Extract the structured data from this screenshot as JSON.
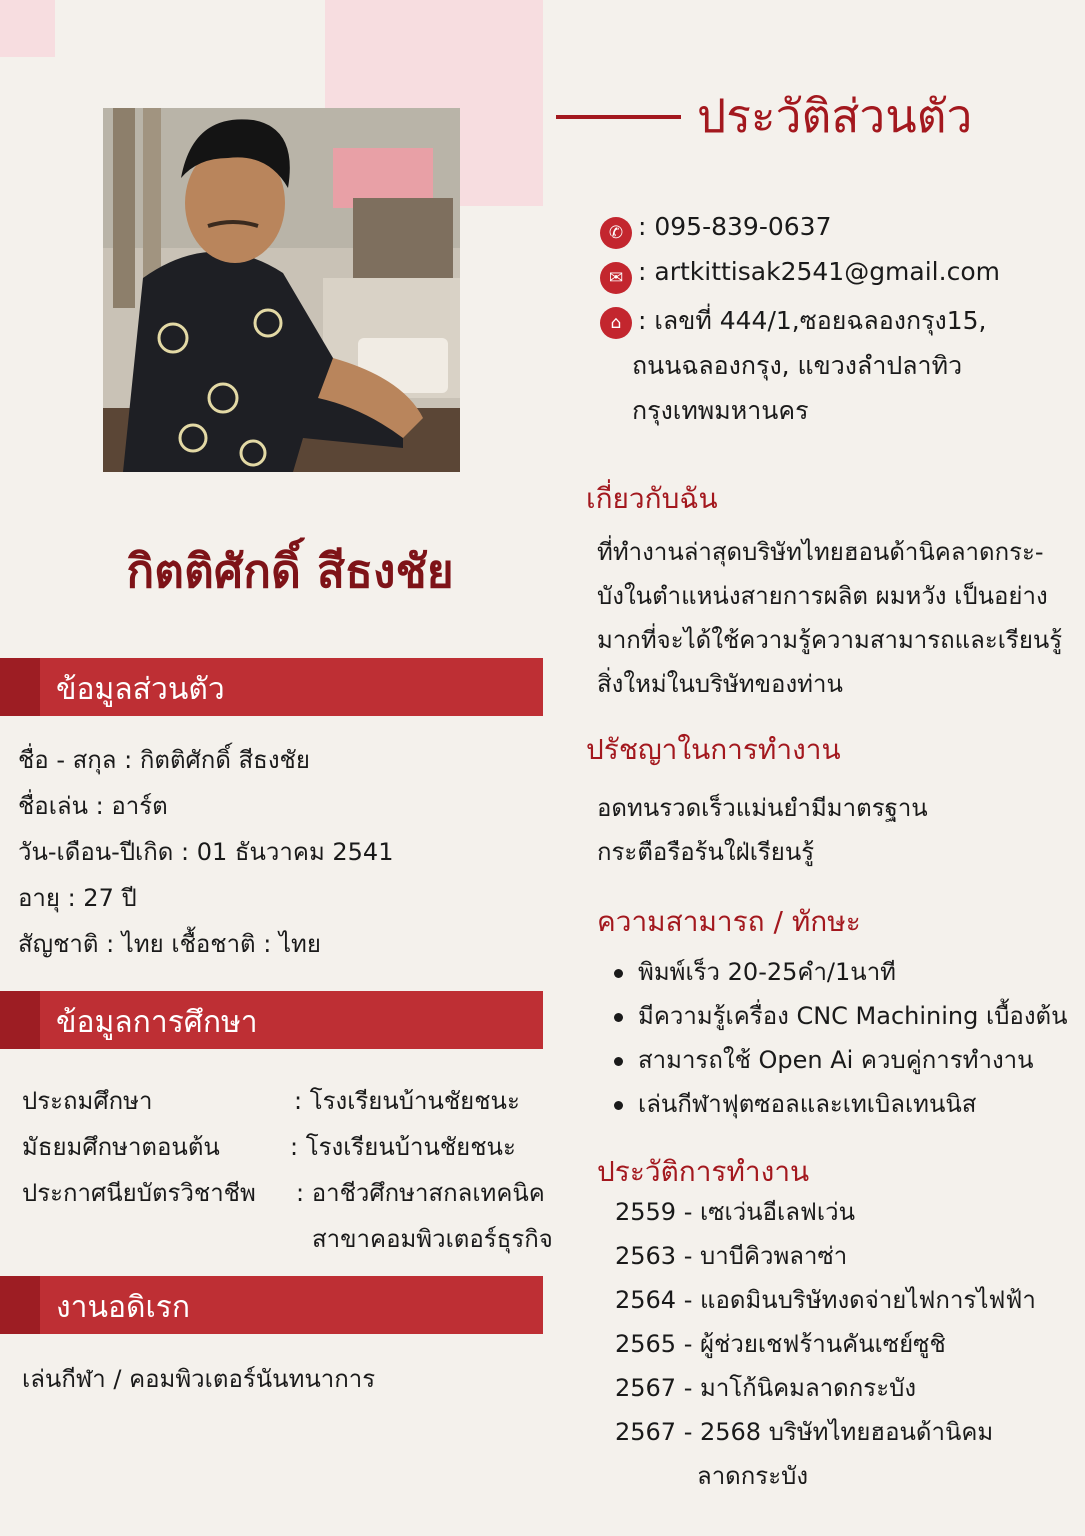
{
  "colors": {
    "accent": "#a3181e",
    "bar": "#be2f34",
    "bar_cap": "#9d1d23",
    "pink": "#f7dde0",
    "background": "#f4f1ec"
  },
  "name": "กิตติศักดิ์ สีธงชัย",
  "headline": "ประวัติส่วนตัว",
  "contact": {
    "phone": ": 095-839-0637",
    "email": ": artkittisak2541@gmail.com",
    "address_lines": [
      ": เลขที่ 444/1,ซอยฉลองกรุง15,",
      "ถนนฉลองกรุง, แขวงลำปลาทิว",
      "กรุงเทพมหานคร"
    ],
    "icons": [
      "phone-icon",
      "email-icon",
      "home-icon"
    ]
  },
  "personal": {
    "heading": "ข้อมูลส่วนตัว",
    "lines": [
      "ชื่อ - สกุล : กิตติศักดิ์ สีธงชัย",
      "ชื่อเล่น : อาร์ต",
      "วัน-เดือน-ปีเกิด : 01 ธันวาคม 2541",
      "อายุ : 27 ปี",
      "สัญชาติ : ไทย  เชื้อชาติ : ไทย"
    ]
  },
  "education": {
    "heading": "ข้อมูลการศึกษา",
    "rows": [
      {
        "level": "ประถมศึกษา",
        "school": ": โรงเรียนบ้านชัยชนะ"
      },
      {
        "level": "มัธยมศึกษาตอนต้น",
        "school": ": โรงเรียนบ้านชัยชนะ"
      },
      {
        "level": "ประกาศนียบัตรวิชาชีพ",
        "school": ": อาชีวศึกษาสกลเทคนิค"
      }
    ],
    "extra_line": "สาขาคอมพิวเตอร์ธุรกิจ"
  },
  "hobby": {
    "heading": "งานอดิเรก",
    "text": "เล่นกีฬา / คอมพิวเตอร์นันทนาการ"
  },
  "about": {
    "heading": "เกี่ยวกับฉัน",
    "lines": [
      "ที่ทำงานล่าสุดบริษัทไทยฮอนด้านิคลาดกระ-",
      "บังในตำแหน่งสายการผลิต ผมหวัง เป็นอย่าง",
      "มากที่จะได้ใช้ความรู้ความสามารถและเรียนรู้",
      "สิ่งใหม่ในบริษัทของท่าน"
    ]
  },
  "philosophy": {
    "heading": "ปรัชญาในการทำงาน",
    "lines": [
      "อดทนรวดเร็วแม่นยำมีมาตรฐาน",
      "กระตือรือร้นใฝ่เรียนรู้"
    ]
  },
  "skills": {
    "heading": "ความสามารถ / ทักษะ",
    "items": [
      "พิมพ์เร็ว 20-25คำ/1นาที",
      "มีความรู้เครื่อง CNC Machining เบื้องต้น",
      "สามารถใช้ Open Ai ควบคู่การทำงาน",
      "เล่นกีฬาฟุตซอลและเทเบิลเทนนิส"
    ]
  },
  "work": {
    "heading": "ประวัติการทำงาน",
    "items": [
      "2559 - เซเว่นอีเลฟเว่น",
      "2563 - บาบีคิวพลาซ่า",
      "2564 - แอดมินบริษัทงดจ่ายไฟการไฟฟ้า",
      "2565 - ผู้ช่วยเชฟร้านคันเซย์ซูชิ",
      "2567 - มาโก้นิคมลาดกระบัง",
      "2567 - 2568 บริษัทไทยฮอนด้านิคม"
    ],
    "extra_line": "ลาดกระบัง"
  }
}
